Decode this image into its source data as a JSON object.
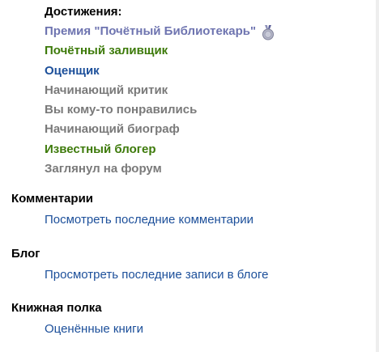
{
  "achievements": {
    "heading": "Достижения:",
    "items": [
      {
        "label": "Премия \"Почётный Библиотекарь\"",
        "color": "#6e74b0",
        "medal_icon": "medal-icon"
      },
      {
        "label": "Почётный заливщик",
        "color": "#3d7a0a"
      },
      {
        "label": "Оценщик",
        "color": "#1c4f9a"
      },
      {
        "label": "Начинающий критик",
        "color": "#7a7a7a"
      },
      {
        "label": "Вы кому-то понравились",
        "color": "#7a7a7a"
      },
      {
        "label": "Начинающий биограф",
        "color": "#7a7a7a"
      },
      {
        "label": "Известный блогер",
        "color": "#3d7a0a"
      },
      {
        "label": "Заглянул на форум",
        "color": "#7a7a7a"
      }
    ]
  },
  "comments": {
    "title": "Комментарии",
    "link": "Посмотреть последние комментарии"
  },
  "blog": {
    "title": "Блог",
    "link": "Просмотреть последние записи в блоге"
  },
  "bookshelf": {
    "title": "Книжная полка",
    "link": "Оценённые книги"
  }
}
